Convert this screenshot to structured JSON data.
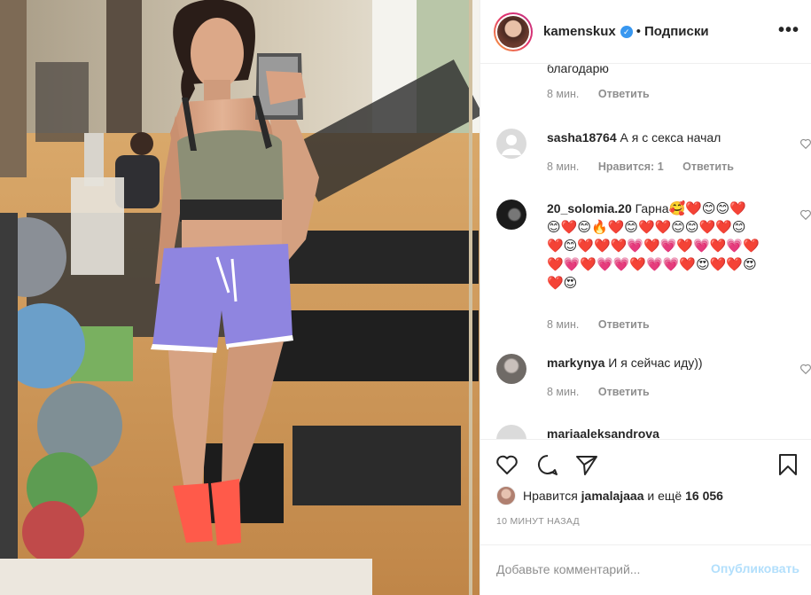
{
  "header": {
    "username": "kamenskux",
    "verified_badge": "✓",
    "separator": "•",
    "follow_status": "Подписки",
    "more_icon": "more-horizontal-icon"
  },
  "comments": [
    {
      "user": "",
      "text": "благодарю",
      "time": "8 мин.",
      "likes": "",
      "reply": "Ответить",
      "avatar_color": ""
    },
    {
      "user": "sasha18764",
      "text": "А я с секса начал",
      "time": "8 мин.",
      "likes": "Нравится: 1",
      "reply": "Ответить",
      "avatar_color": "#dbdbdb"
    },
    {
      "user": "20_solomia.20",
      "text": "Гарна",
      "emojis": "🥰❤️😊😊❤️😊❤️😊🔥❤️😊❤️❤️😊😊❤️❤️😊❤️😊❤️❤️❤️💗❤️💗❤️💗❤️💗❤️❤️💗❤️💗💗❤️💗💗❤️😍❤️❤️😍❤️😍",
      "time": "8 мин.",
      "likes": "",
      "reply": "Ответить",
      "avatar_color": "#2b2b2b"
    },
    {
      "user": "markynya",
      "text": "И я сейчас иду))",
      "time": "8 мин.",
      "likes": "",
      "reply": "Ответить",
      "avatar_color": "#9a9a9a"
    },
    {
      "user": "mariaaleksandrova",
      "text": "",
      "time": "",
      "likes": "",
      "reply": "",
      "avatar_color": "#dbdbdb"
    }
  ],
  "actions": {
    "like_icon": "heart-icon",
    "comment_icon": "comment-icon",
    "share_icon": "paper-plane-icon",
    "save_icon": "bookmark-icon"
  },
  "likes": {
    "prefix": "Нравится",
    "user": "jamalajaaa",
    "middle": "и ещё",
    "count": "16 056"
  },
  "timestamp": "10 МИНУТ НАЗАД",
  "comment_box": {
    "placeholder": "Добавьте комментарий...",
    "publish_label": "Опубликовать"
  },
  "colors": {
    "text": "#262626",
    "secondary": "#8e8e8e",
    "link_disabled": "#b2dffc",
    "verified": "#3897f0"
  }
}
